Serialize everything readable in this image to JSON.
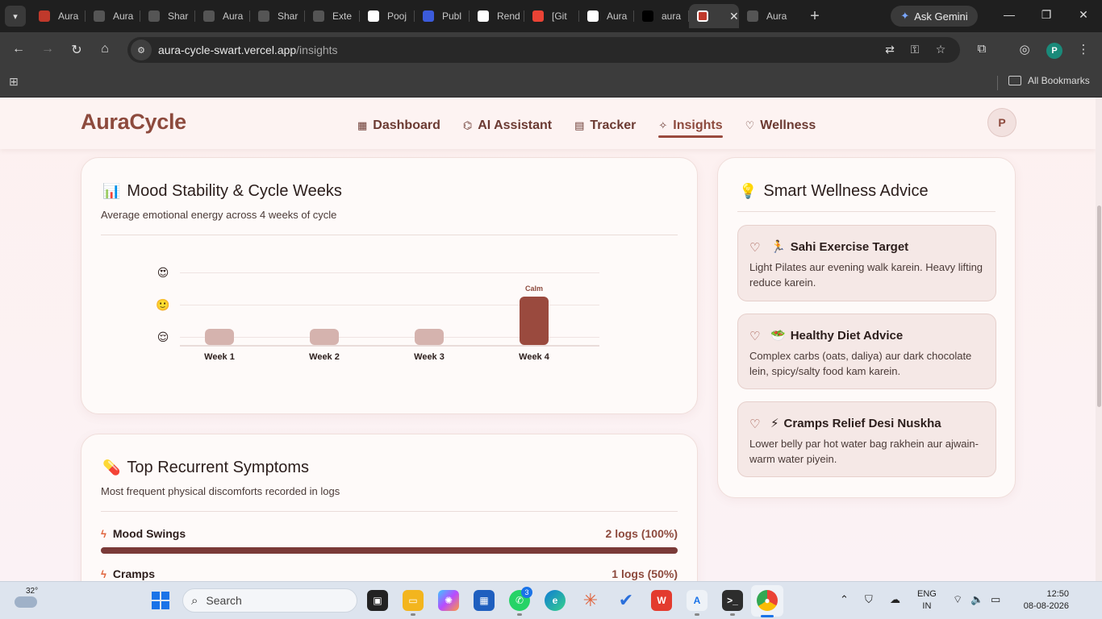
{
  "browser": {
    "tabs": [
      {
        "label": "Aura",
        "fav_color": "#c0392b"
      },
      {
        "label": "Aura",
        "fav_color": "#555555"
      },
      {
        "label": "Shar",
        "fav_color": "#555555"
      },
      {
        "label": "Aura",
        "fav_color": "#555555"
      },
      {
        "label": "Shar",
        "fav_color": "#555555"
      },
      {
        "label": "Exte",
        "fav_color": "#555555"
      },
      {
        "label": "Pooj",
        "fav_color": "#ffffff"
      },
      {
        "label": "Publ",
        "fav_color": "#3b5bdb"
      },
      {
        "label": "Rend",
        "fav_color": "#ffffff"
      },
      {
        "label": "[Git",
        "fav_color": "#ea4335"
      },
      {
        "label": "Aura",
        "fav_color": "#ffffff"
      },
      {
        "label": "aura",
        "fav_color": "#000000"
      }
    ],
    "active_tab_close": "✕",
    "new_tab": "+",
    "gemini_label": "Ask Gemini",
    "url_host": "aura-cycle-swart.vercel.app",
    "url_path": "/insights",
    "bookmarks_label": "All Bookmarks",
    "profile_initial": "P"
  },
  "app": {
    "logo": "AuraCycle",
    "nav": [
      {
        "label": "Dashboard",
        "icon": "grid-icon"
      },
      {
        "label": "AI Assistant",
        "icon": "robot-icon"
      },
      {
        "label": "Tracker",
        "icon": "calendar-icon"
      },
      {
        "label": "Insights",
        "icon": "sparkle-icon",
        "active": true
      },
      {
        "label": "Wellness",
        "icon": "heart-icon"
      }
    ],
    "avatar_initial": "P",
    "accent_color": "#9a4a3e"
  },
  "mood_card": {
    "title": "Mood Stability & Cycle Weeks",
    "subtitle": "Average emotional energy across 4 weeks of cycle",
    "chart_data": {
      "type": "bar",
      "categories": [
        "Week 1",
        "Week 2",
        "Week 3",
        "Week 4"
      ],
      "values": [
        1,
        1,
        1,
        2
      ],
      "y_levels": [
        "😌",
        "🙂",
        "😍"
      ],
      "highlight": {
        "category": "Week 4",
        "label": "Calm"
      },
      "ylim": [
        1,
        3
      ]
    }
  },
  "symptoms_card": {
    "title": "Top Recurrent Symptoms",
    "subtitle": "Most frequent physical discomforts recorded in logs",
    "items": [
      {
        "name": "Mood Swings",
        "count": "2 logs (100%)",
        "fraction": 1.0
      },
      {
        "name": "Cramps",
        "count": "1 logs (50%)",
        "fraction": 0.5
      }
    ]
  },
  "advice_card": {
    "title": "Smart Wellness Advice",
    "items": [
      {
        "emoji": "🏃",
        "title": "Sahi Exercise Target",
        "body": "Light Pilates aur evening walk karein. Heavy lifting reduce karein."
      },
      {
        "emoji": "🥗",
        "title": "Healthy Diet Advice",
        "body": "Complex carbs (oats, daliya) aur dark chocolate lein, spicy/salty food kam karein."
      },
      {
        "emoji": "⚡",
        "title": "Cramps Relief Desi Nuskha",
        "body": "Lower belly par hot water bag rakhein aur ajwain-warm water piyein."
      }
    ]
  },
  "taskbar": {
    "temp": "32°",
    "search_placeholder": "Search",
    "whatsapp_badge": "3",
    "lang_line1": "ENG",
    "lang_line2": "IN",
    "time": "12:50",
    "date": "08-08-2026"
  }
}
